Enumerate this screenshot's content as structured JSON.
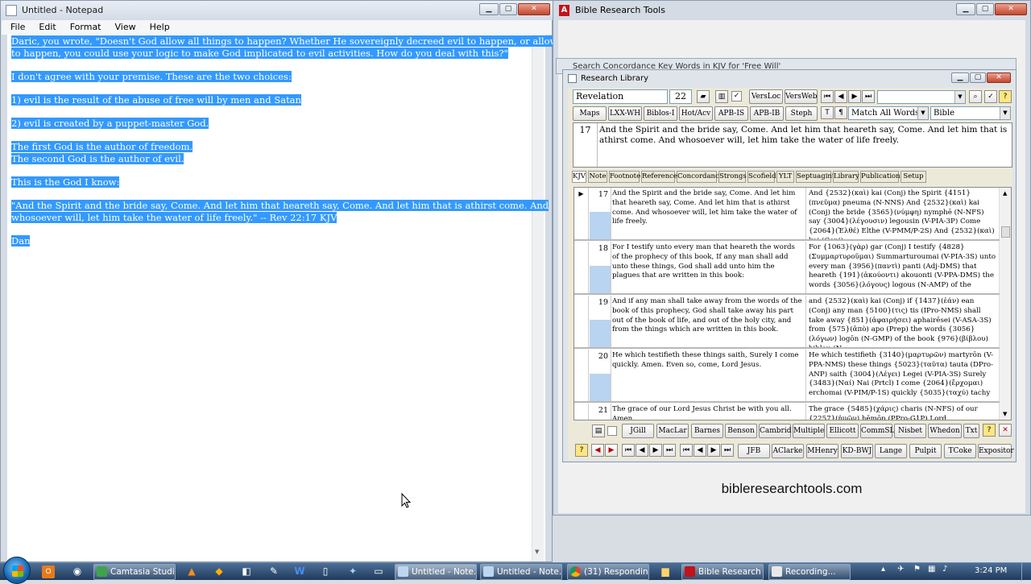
{
  "notepad": {
    "title": "Untitled - Notepad",
    "menu": [
      "File",
      "Edit",
      "Format",
      "View",
      "Help"
    ],
    "lines": [
      "Daric, you wrote, \"Doesn't God allow all things to happen? Whether He sovereignly decreed evil to happen, or allows it",
      "to happen, you could use your logic to make God implicated to evil activities. How do you deal with this?\"",
      "",
      "I don't agree with your premise. These are the two choices:",
      "",
      "1) evil is the result of the abuse of free will by men and Satan",
      "",
      "2) evil is created by a puppet-master God.",
      "",
      "The first God is the author of freedom.",
      "The second God is the author of evil.",
      "",
      "This is the God I know:",
      "",
      "     \"And the Spirit and the bride say, Come. And let him that heareth say, Come. And let him that is athirst come. And",
      "whosoever will, let him take the water of life freely.\" -- Rev 22:17 KJV",
      " ",
      "Dan"
    ]
  },
  "brt": {
    "title": "Bible Research Tools",
    "site": "bibleresearchtools.com"
  },
  "concordance": {
    "title": "Search Concordance Key Words in KJV for 'Free Will'"
  },
  "research_library": {
    "title": "Research Library",
    "book": "Revelation",
    "chapter": "22",
    "toolbar1": [
      "VersLoc",
      "VersWeb"
    ],
    "toolbar2": [
      "Maps",
      "LXX-WH",
      "Biblos-I",
      "Hot/Acv",
      "APB-IS",
      "APB-IB",
      "Steph"
    ],
    "toolbar2_icons": [
      "T",
      "¶"
    ],
    "match_select": "Match All Words",
    "source_select": "Bible",
    "verse_num": "17",
    "verse_text": "And the Spirit and the bride say, Come. And let him that heareth say, Come. And let him that is athirst come. And whosoever will, let him take the water of life freely.",
    "tabs": [
      "KJV",
      "Note",
      "Footnote",
      "Reference",
      "Concordance",
      "Strongs",
      "Scofield",
      "YLT",
      "Septuagint",
      "Library",
      "Publications",
      "Setup"
    ],
    "rows": [
      {
        "num": "17",
        "kjv": "And the Spirit and the bride say, Come. And let him that heareth say, Come. And let him that is athirst come. And whosoever will, let him take the water of life freely.",
        "greek": "And {2532}(καὶ) kai (Conj)  the Spirit {4151}(πνεῦμα) pneuma (N-NNS)  And {2532}(καὶ) kai (Conj)  the bride {3565}(νύμφη) nymphē (N-NFS)  say {3004}(λέγουσιν) legousin (V-PIA-3P)  Come {2064}(Ἐλθέ) Elthe (V-PMM/P-2S)  And {2532}(καὶ) kai (Conj)"
      },
      {
        "num": "18",
        "kjv": "For I testify unto every man that heareth the words of the prophecy of this book, If any man shall add unto these things, God shall add unto him the plagues that are written in this book:",
        "greek": "For {1063}(γὰρ) gar (Conj)  I testify {4828}(Συμμαρτυροῦμαι) Summarturoumai (V-PIA-3S)  unto every man {3956}(παντὶ) panti (Adj-DMS)  that heareth {191}(ἀκούοντι) akouonti (V-PPA-DMS)  the words {3056}(λόγους) logous (N-AMP)  of the"
      },
      {
        "num": "19",
        "kjv": "And if any man shall take away from the words of the book of this prophecy, God shall take away his part out of the book of life, and out of the holy city, and from the things which are written in this book.",
        "greek": "and {2532}(καὶ) kai (Conj)  if {1437}(ἐάν) ean (Conj)  any man {5100}(τις) tis (IPro-NMS)  shall take away {851}(ἀφαιρήσει) aphairēsei (V-ASA-3S)  from {575}(ἀπὸ) apo (Prep)  the words {3056}(λόγων) logōn (N-GMP)  of the book {976}(βίβλου) biblou (N-"
      },
      {
        "num": "20",
        "kjv": "He which testifieth these things saith, Surely I come quickly. Amen. Even so, come, Lord Jesus.",
        "greek": "He which testifieth {3140}(μαρτυρῶν) martyrōn (V-PPA-NMS)  these things {5023}(ταῦτα) tauta (DPro-ANP)  saith {3004}(Λέγει) Legei (V-PIA-3S)  Surely {3483}(Ναί) Nai (Prtcl)  I come {2064}(ἔρχομαι) erchomai (V-PIM/P-1S)  quickly {5035}(ταχύ) tachy"
      },
      {
        "num": "21",
        "kjv": "The grace of our Lord Jesus Christ be with you all. Amen.",
        "greek": "The grace {5485}(χάρις) charis (N-NFS)  of our {2257}(ἡμῶν) hēmōn (PPro-G1P)  Lord"
      }
    ],
    "commentary_buttons": [
      "JGill",
      "MacLar",
      "Barnes",
      "Benson",
      "Cambrid",
      "Multiple",
      "Ellicott",
      "CommSL",
      "Nisbet",
      "Whedon",
      "Txt"
    ],
    "bottom_buttons": [
      "JFB",
      "AClarke",
      "MHenry",
      "KD-BWJ",
      "Lange",
      "Pulpit",
      "TCoke",
      "Expositor"
    ]
  },
  "taskbar": {
    "tasks": [
      "Camtasia Studi...",
      "Untitled - Note...",
      "Untitled - Note...",
      "(31) Respondin...",
      "Bible Research ...",
      "Recording..."
    ],
    "clock": "3:24 PM"
  }
}
